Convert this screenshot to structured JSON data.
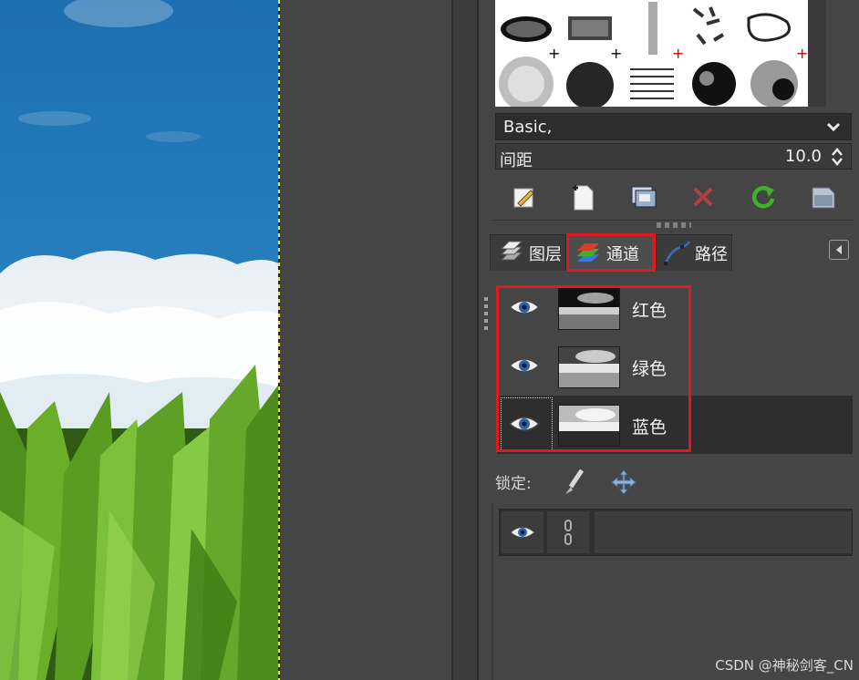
{
  "brushes": {
    "preset_label": "Basic,",
    "tiles": [
      "brush-1",
      "brush-2",
      "brush-3",
      "brush-4",
      "brush-5",
      "brush-6",
      "brush-7",
      "brush-8",
      "brush-9",
      "brush-10"
    ]
  },
  "spacing": {
    "label": "间距",
    "value": "10.0",
    "fill_fraction": 0.0
  },
  "actions": {
    "icons": [
      "edit-brush-icon",
      "new-brush-icon",
      "duplicate-brush-icon",
      "delete-brush-icon",
      "refresh-brushes-icon",
      "open-as-image-icon"
    ]
  },
  "tabs": [
    {
      "label": "图层",
      "icon": "layers-icon"
    },
    {
      "label": "通道",
      "icon": "channels-icon",
      "active": true
    },
    {
      "label": "路径",
      "icon": "paths-icon"
    }
  ],
  "channels": [
    {
      "label": "红色",
      "visible": true,
      "selected": false
    },
    {
      "label": "绿色",
      "visible": true,
      "selected": false
    },
    {
      "label": "蓝色",
      "visible": true,
      "selected": true
    }
  ],
  "lock": {
    "label": "锁定:",
    "icons": [
      "lock-pixels-icon",
      "lock-position-icon"
    ]
  },
  "colors": {
    "highlight": "#e0191f",
    "panel_bg": "#454545"
  },
  "watermark": "CSDN @神秘剑客_CN"
}
